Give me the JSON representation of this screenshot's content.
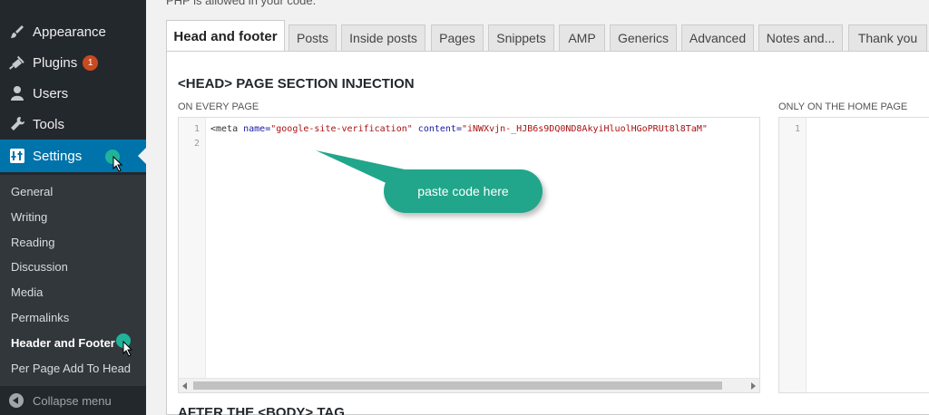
{
  "sidebar": {
    "menu": [
      {
        "label": "Appearance",
        "icon": "paintbrush-icon"
      },
      {
        "label": "Plugins",
        "icon": "plugin-icon",
        "badge": "1"
      },
      {
        "label": "Users",
        "icon": "user-icon"
      },
      {
        "label": "Tools",
        "icon": "wrench-icon"
      },
      {
        "label": "Settings",
        "icon": "settings-icon",
        "active": true
      }
    ],
    "submenu": [
      {
        "label": "General"
      },
      {
        "label": "Writing"
      },
      {
        "label": "Reading"
      },
      {
        "label": "Discussion"
      },
      {
        "label": "Media"
      },
      {
        "label": "Permalinks"
      },
      {
        "label": "Header and Footer",
        "current": true
      },
      {
        "label": "Per Page Add To Head"
      }
    ],
    "collapse_label": "Collapse menu"
  },
  "top_note": "PHP is allowed in your code.",
  "tabs": [
    {
      "label": "Head and footer",
      "active": true
    },
    {
      "label": "Posts"
    },
    {
      "label": "Inside posts"
    },
    {
      "label": "Pages"
    },
    {
      "label": "Snippets"
    },
    {
      "label": "AMP"
    },
    {
      "label": "Generics"
    },
    {
      "label": "Advanced"
    },
    {
      "label": "Notes and..."
    },
    {
      "label": "Thank you"
    }
  ],
  "section": {
    "title": "<HEAD> PAGE SECTION INJECTION",
    "every_page_label": "ON EVERY PAGE",
    "home_page_label": "ONLY ON THE HOME PAGE",
    "after_body_title": "AFTER THE <BODY> TAG"
  },
  "editor_every": {
    "line_numbers": [
      "1",
      "2"
    ],
    "code": {
      "tag_open": "<meta ",
      "attr1": "name=",
      "val1": "\"google-site-verification\"",
      "attr2": " content=",
      "val2": "\"iNWXvjn-_HJB6s9DQ0ND8AkyiHluolHGoPRUt8l8TaM\""
    }
  },
  "editor_home": {
    "line_numbers": [
      "1"
    ]
  },
  "callout": {
    "text": "paste code here"
  },
  "colors": {
    "sidebar_bg": "#23282d",
    "submenu_bg": "#32373c",
    "active_bg": "#0073aa",
    "badge": "#ca4a1f",
    "callout": "#21a68b"
  }
}
